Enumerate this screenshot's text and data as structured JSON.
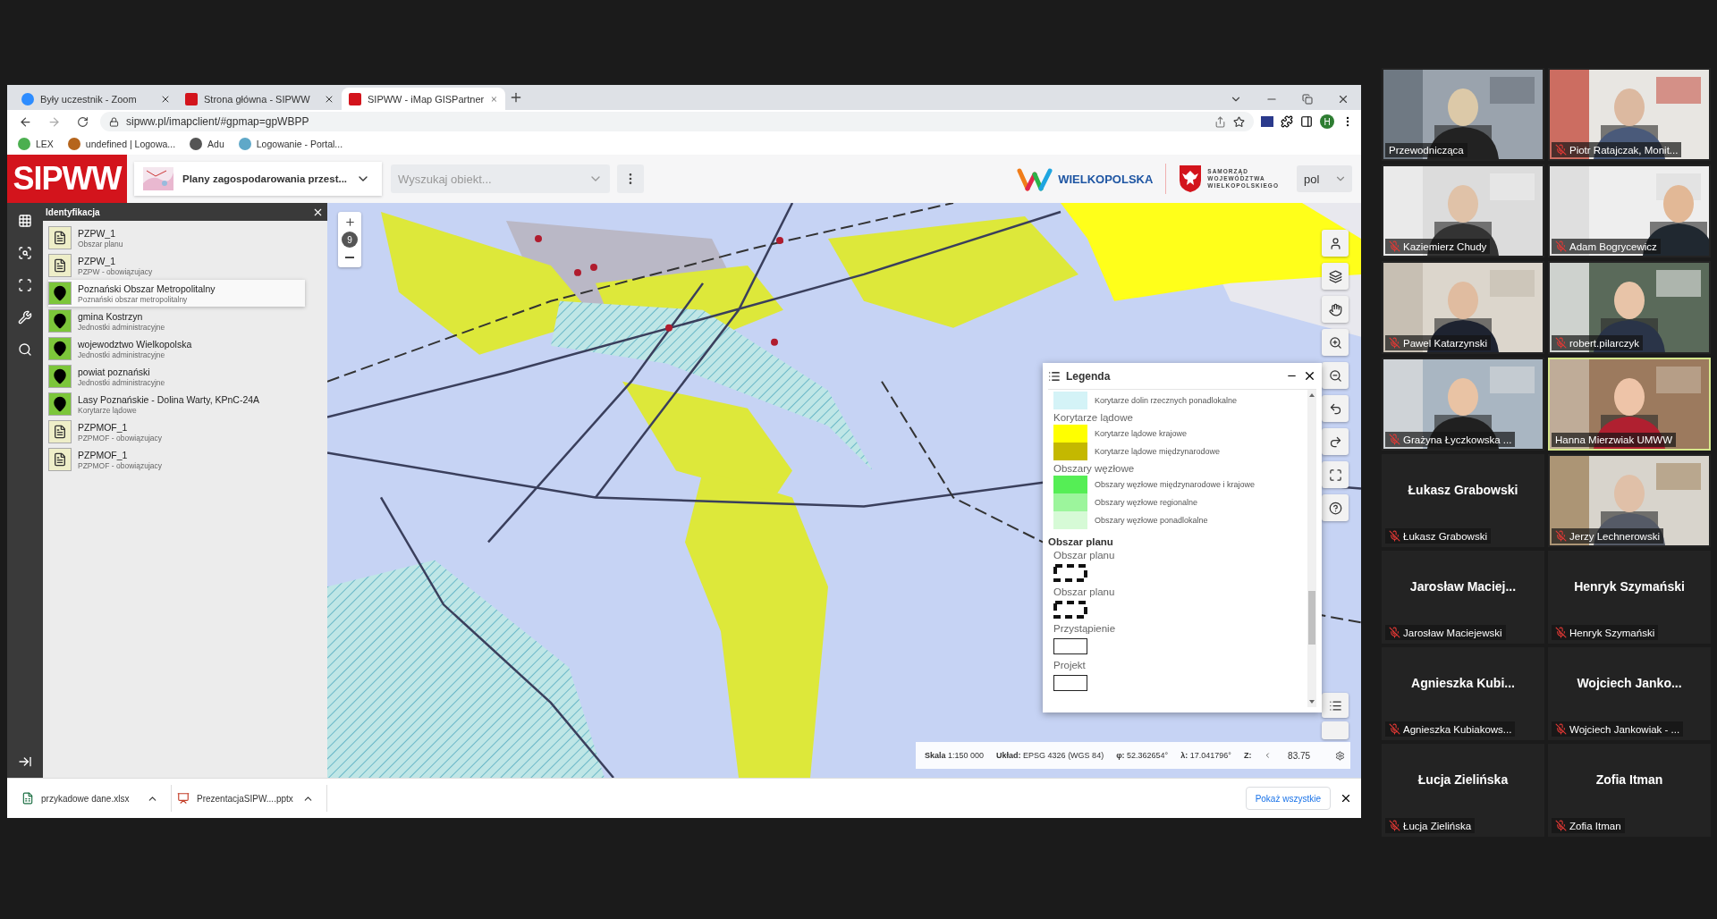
{
  "browser": {
    "tabs": [
      {
        "title": "Były uczestnik - Zoom",
        "kind": "zoom",
        "selected": false
      },
      {
        "title": "Strona główna - SIPWW",
        "kind": "sip",
        "selected": false
      },
      {
        "title": "SIPWW - iMap GISPartner",
        "kind": "sip",
        "selected": true
      }
    ],
    "url": "sipww.pl/imapclient/#gpmap=gpWBPP",
    "profile_initial": "H",
    "bookmarks": [
      {
        "label": "LEX",
        "color": "#4caf50"
      },
      {
        "label": "undefined | Logowa...",
        "color": "#b5651d"
      },
      {
        "label": "Adu",
        "color": "#555555"
      },
      {
        "label": "Logowanie - Portal...",
        "color": "#5fa8c8"
      }
    ]
  },
  "app": {
    "logo": "SIPWW",
    "map_selector": "Plany zagospodarowania przest...",
    "search": {
      "placeholder": "Wyszukaj obiekt..."
    },
    "brand": "WIELKOPOLSKA",
    "authority": "SAMORZĄD\nWOJEWÓDZTWA\nWIELKOPOLSKIEGO",
    "language": "pol"
  },
  "identification": {
    "title": "Identyfikacja",
    "items": [
      {
        "kind": "document",
        "title": "PZPW_1",
        "subtitle": "Obszar planu",
        "selected": false
      },
      {
        "kind": "document",
        "title": "PZPW_1",
        "subtitle": "PZPW - obowiązujacy",
        "selected": false
      },
      {
        "kind": "marker",
        "title": "Poznański Obszar Metropolitalny",
        "subtitle": "Poznański obszar metropolitalny",
        "selected": true
      },
      {
        "kind": "marker",
        "title": "gmina Kostrzyn",
        "subtitle": "Jednostki administracyjne",
        "selected": false
      },
      {
        "kind": "marker",
        "title": "wojewodztwo Wielkopolska",
        "subtitle": "Jednostki administracyjne",
        "selected": false
      },
      {
        "kind": "marker",
        "title": "powiat poznański",
        "subtitle": "Jednostki administracyjne",
        "selected": false
      },
      {
        "kind": "marker",
        "title": "Lasy Poznańskie - Dolina Warty, KPnC-24A",
        "subtitle": "Korytarze lądowe",
        "selected": false
      },
      {
        "kind": "document",
        "title": "PZPMOF_1",
        "subtitle": "PZPMOF - obowiązujacy",
        "selected": false
      },
      {
        "kind": "document",
        "title": "PZPMOF_1",
        "subtitle": "PZPMOF - obowiązujacy",
        "selected": false
      }
    ]
  },
  "map": {
    "zoom_level": "9"
  },
  "legend": {
    "title": "Legenda",
    "items": [
      {
        "kind": "swatch",
        "label": "Korytarze dolin rzecznych ponadlokalne",
        "color": "#d4f3f7"
      },
      {
        "kind": "group",
        "label": "Korytarze lądowe"
      },
      {
        "kind": "swatch",
        "label": "Korytarze lądowe krajowe",
        "color": "#ffff00"
      },
      {
        "kind": "swatch",
        "label": "Korytarze lądowe międzynarodowe",
        "color": "#c4b800"
      },
      {
        "kind": "group",
        "label": "Obszary węzłowe"
      },
      {
        "kind": "swatch",
        "label": "Obszary węzłowe międzynarodowe i krajowe",
        "color": "#55ee55"
      },
      {
        "kind": "swatch",
        "label": "Obszary węzłowe regionalne",
        "color": "#9cf59c"
      },
      {
        "kind": "swatch",
        "label": "Obszary węzłowe ponadlokalne",
        "color": "#d6fad6"
      },
      {
        "kind": "section",
        "label": "Obszar planu"
      },
      {
        "kind": "group",
        "label": "Obszar planu"
      },
      {
        "kind": "dashed"
      },
      {
        "kind": "group",
        "label": "Obszar planu"
      },
      {
        "kind": "dashed"
      },
      {
        "kind": "group",
        "label": "Przystąpienie"
      },
      {
        "kind": "outline"
      },
      {
        "kind": "group",
        "label": "Projekt"
      },
      {
        "kind": "outline"
      }
    ]
  },
  "status_bar": {
    "scale": "**Skala** 1:150 000",
    "crs": "**Układ:** EPSG 4326 (WGS 84)",
    "lat": "**φ:** 52.362654°",
    "lon": "**λ:** 17.041796°",
    "z_label": "Z:",
    "z_value": "83.75"
  },
  "downloads": {
    "files": [
      {
        "name": "przykadowe dane.xlsx",
        "kind": "spreadsheet"
      },
      {
        "name": "PrezentacjaSIPW....pptx",
        "kind": "presentation"
      }
    ],
    "show_all": "Pokaż wszystkie"
  },
  "participants": [
    {
      "kind": "video",
      "name": "Przewodnicząca",
      "muted": false,
      "speaking": false
    },
    {
      "kind": "video",
      "name": "Piotr Ratajczak, Monit...",
      "muted": true,
      "speaking": false
    },
    {
      "kind": "video",
      "name": "Kaziemierz Chudy",
      "muted": true,
      "speaking": false
    },
    {
      "kind": "video",
      "name": "Adam Bogrycewicz",
      "muted": true,
      "speaking": false
    },
    {
      "kind": "video",
      "name": "Pawel Katarzynski",
      "muted": true,
      "speaking": false
    },
    {
      "kind": "video",
      "name": "robert.pilarczyk",
      "muted": true,
      "speaking": false
    },
    {
      "kind": "video",
      "name": "Grażyna Łyczkowska ...",
      "muted": true,
      "speaking": false
    },
    {
      "kind": "video",
      "name": "Hanna Mierzwiak UMWW",
      "muted": false,
      "speaking": true
    },
    {
      "kind": "name",
      "display": "Łukasz Grabowski",
      "name": "Łukasz Grabowski",
      "muted": true,
      "speaking": false
    },
    {
      "kind": "video",
      "name": "Jerzy Lechnerowski",
      "muted": true,
      "speaking": false
    },
    {
      "kind": "name",
      "display": "Jarosław Maciej...",
      "name": "Jarosław Maciejewski",
      "muted": true,
      "speaking": false
    },
    {
      "kind": "name",
      "display": "Henryk Szymański",
      "name": "Henryk Szymański",
      "muted": true,
      "speaking": false
    },
    {
      "kind": "name",
      "display": "Agnieszka Kubi...",
      "name": "Agnieszka Kubiakows...",
      "muted": true,
      "speaking": false
    },
    {
      "kind": "name",
      "display": "Wojciech Janko...",
      "name": "Wojciech Jankowiak - ...",
      "muted": true,
      "speaking": false
    },
    {
      "kind": "name",
      "display": "Łucja Zielińska",
      "name": "Łucja Zielińska",
      "muted": true,
      "speaking": false
    },
    {
      "kind": "name",
      "display": "Zofia Itman",
      "name": "Zofia Itman",
      "muted": true,
      "speaking": false
    }
  ]
}
